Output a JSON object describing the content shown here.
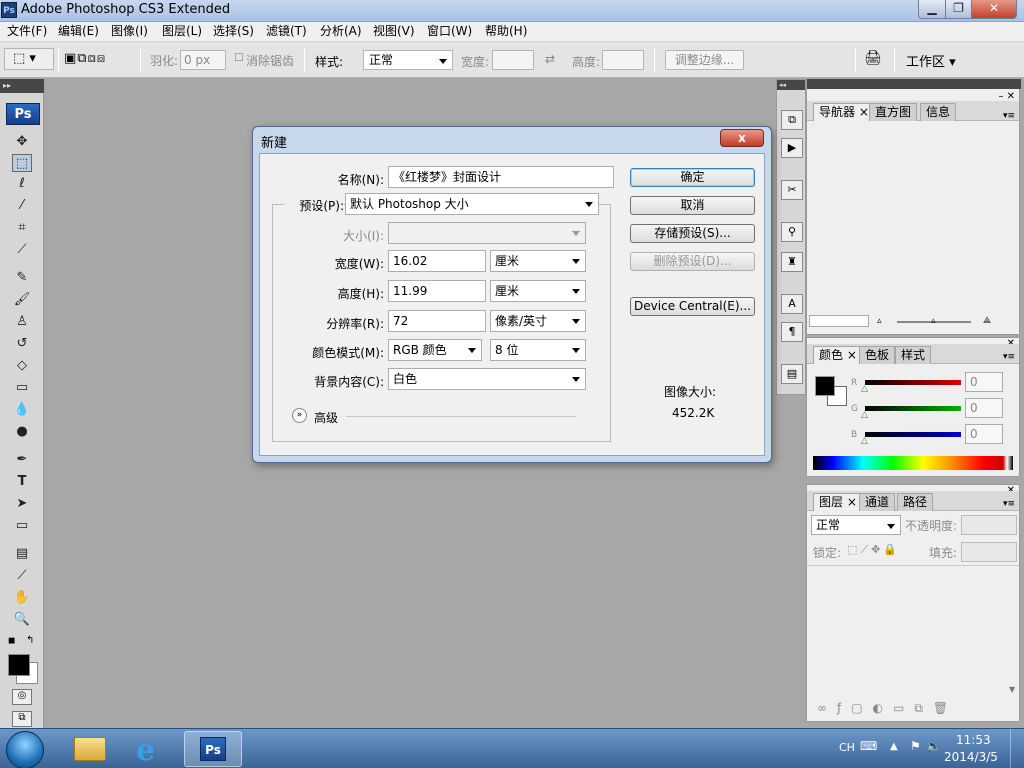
{
  "window": {
    "title": "Adobe Photoshop CS3 Extended",
    "app_icon": "Ps"
  },
  "menu": [
    "文件(F)",
    "编辑(E)",
    "图像(I)",
    "图层(L)",
    "选择(S)",
    "滤镜(T)",
    "分析(A)",
    "视图(V)",
    "窗口(W)",
    "帮助(H)"
  ],
  "options": {
    "feather_label": "羽化:",
    "feather_value": "0 px",
    "antialias_label": "消除锯齿",
    "style_label": "样式:",
    "style_value": "正常",
    "width_label": "宽度:",
    "height_label": "高度:",
    "refine_edge": "调整边缘...",
    "workspace": "工作区"
  },
  "toolbox": {
    "logo": "Ps"
  },
  "dialog": {
    "title": "新建",
    "close": "x",
    "name_label": "名称(N):",
    "name_value": "《红楼梦》封面设计",
    "preset_label": "预设(P):",
    "preset_value": "默认 Photoshop 大小",
    "size_label": "大小(I):",
    "width_label": "宽度(W):",
    "width_value": "16.02",
    "width_unit": "厘米",
    "height_label": "高度(H):",
    "height_value": "11.99",
    "height_unit": "厘米",
    "resolution_label": "分辨率(R):",
    "resolution_value": "72",
    "resolution_unit": "像素/英寸",
    "color_mode_label": "颜色模式(M):",
    "color_mode_value": "RGB 颜色",
    "bit_depth_value": "8 位",
    "background_label": "背景内容(C):",
    "background_value": "白色",
    "advanced_label": "高级",
    "ok": "确定",
    "cancel": "取消",
    "save_preset": "存储预设(S)...",
    "delete_preset": "删除预设(D)...",
    "device_central": "Device Central(E)...",
    "image_size_label": "图像大小:",
    "image_size_value": "452.2K"
  },
  "panels": {
    "nav_tabs": [
      "导航器",
      "直方图",
      "信息"
    ],
    "color_tabs": [
      "颜色",
      "色板",
      "样式"
    ],
    "color_channels": [
      {
        "label": "R",
        "value": "0",
        "color": "#e00000"
      },
      {
        "label": "G",
        "value": "0",
        "color": "#00b000"
      },
      {
        "label": "B",
        "value": "0",
        "color": "#0000d0"
      }
    ],
    "layers_tabs": [
      "图层",
      "通道",
      "路径"
    ],
    "blend_mode": "正常",
    "opacity_label": "不透明度:",
    "lock_label": "锁定:",
    "fill_label": "填充:"
  },
  "taskbar": {
    "lang": "CH",
    "time": "11:53",
    "date": "2014/3/5"
  }
}
